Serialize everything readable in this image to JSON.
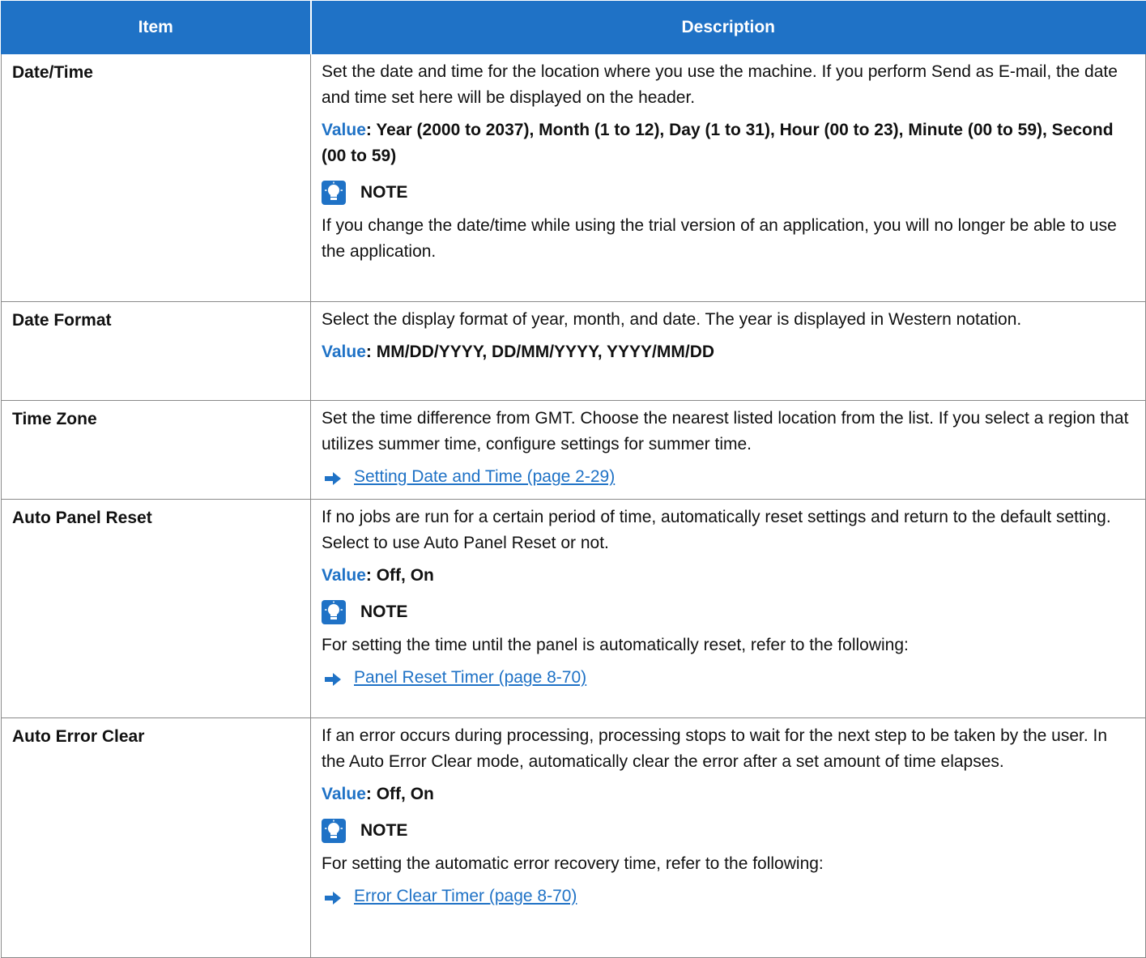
{
  "header": {
    "item": "Item",
    "description": "Description"
  },
  "rows": [
    {
      "item": "Date/Time",
      "description": "Set the date and time for the location where you use the machine. If you perform Send as E-mail, the date and time set here will be displayed on the header.",
      "value_label": "Value",
      "value_text": ": Year (2000 to 2037), Month (1 to 12), Day (1 to 31), Hour (00 to 23), Minute (00 to 59), Second (00 to 59)",
      "note_title": "NOTE",
      "note_text": "If you change the date/time while using the trial version of an application, you will no longer be able to use the application."
    },
    {
      "item": "Date Format",
      "description": "Select the display format of year, month, and date. The year is displayed in Western notation.",
      "value_label": "Value",
      "value_text": ": MM/DD/YYYY, DD/MM/YYYY, YYYY/MM/DD"
    },
    {
      "item": "Time Zone",
      "description": "Set the time difference from GMT. Choose the nearest listed location from the list. If you select a region that utilizes summer time, configure settings for summer time.",
      "link": "Setting Date and Time (page 2-29)"
    },
    {
      "item": "Auto Panel Reset",
      "description": "If no jobs are run for a certain period of time, automatically reset settings and return to the default setting. Select to use Auto Panel Reset or not.",
      "value_label": "Value",
      "value_text": ": Off, On",
      "note_title": "NOTE",
      "note_text": "For setting the time until the panel is automatically reset, refer to the following:",
      "link": "Panel Reset Timer (page 8-70)"
    },
    {
      "item": "Auto Error Clear",
      "description": "If an error occurs during processing, processing stops to wait for the next step to be taken by the user. In the Auto Error Clear mode, automatically clear the error after a set amount of time elapses.",
      "value_label": "Value",
      "value_text": ": Off, On",
      "note_title": "NOTE",
      "note_text": "For setting the automatic error recovery time, refer to the following:",
      "link": "Error Clear Timer (page 8-70)"
    }
  ],
  "colors": {
    "header_bg": "#1f72c6",
    "accent": "#1f72c6",
    "border": "#8a8a8a"
  },
  "icons": {
    "note": "lightbulb-note-icon",
    "link": "right-arrow-icon"
  }
}
